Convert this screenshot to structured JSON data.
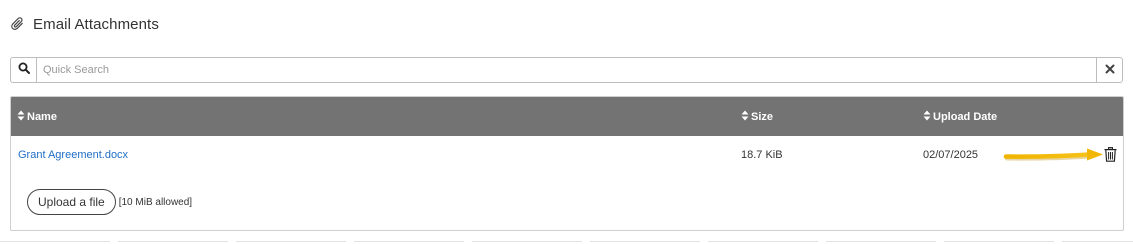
{
  "header": {
    "icon": "paperclip-icon",
    "title": "Email Attachments"
  },
  "search": {
    "icon": "search-icon",
    "placeholder": "Quick Search",
    "value": "",
    "clear_icon": "close-icon"
  },
  "table": {
    "sort_icon": "sort-icon",
    "columns": [
      "Name",
      "Size",
      "Upload Date"
    ],
    "rows": [
      {
        "name": "Grant Agreement.docx",
        "size": "18.7 KiB",
        "upload_date": "02/07/2025",
        "action_icon": "trash-icon"
      }
    ],
    "header_color": "#737373",
    "link_color": "#1f6fc5"
  },
  "upload": {
    "button_label": "Upload a file",
    "note": "[10 MiB allowed]"
  },
  "annotation": {
    "icon": "arrow-right-icon",
    "color": "#f2b705"
  }
}
